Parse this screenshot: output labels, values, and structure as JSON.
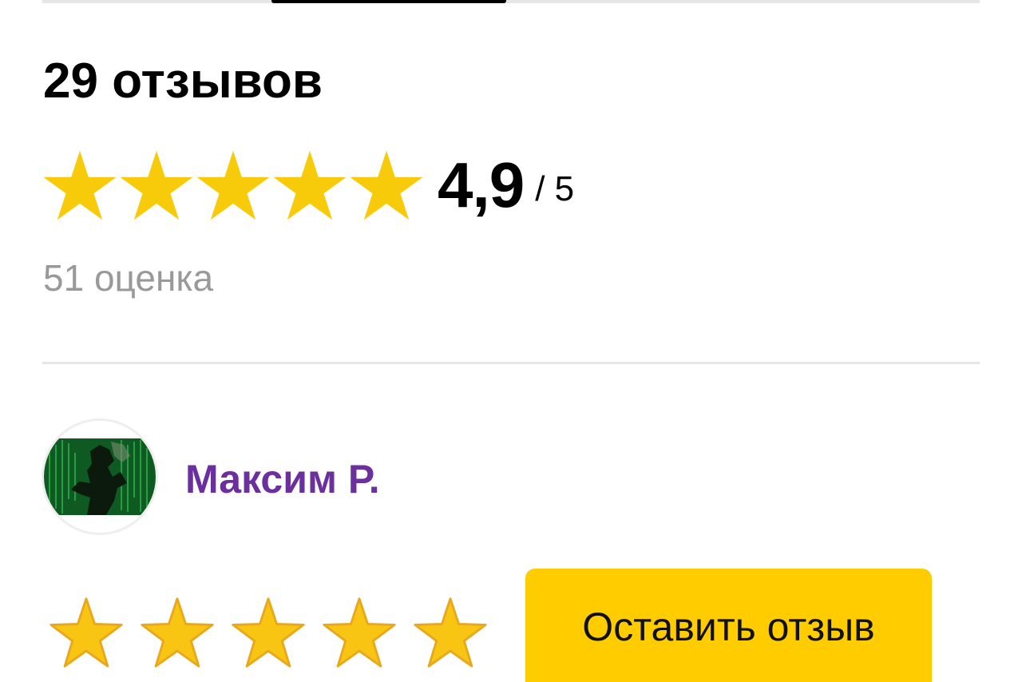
{
  "reviews": {
    "title": "29 отзывов",
    "rating_value": "4,9",
    "rating_max": "/ 5",
    "ratings_count": "51 оценка",
    "overall_stars": 5
  },
  "review": {
    "author": "Максим Р.",
    "stars": 5
  },
  "actions": {
    "leave_review_label": "Оставить отзыв"
  },
  "colors": {
    "star": "#f8cb0a",
    "star_outline": "#e9a81b",
    "author": "#6b2f9e",
    "button": "#ffcc00",
    "muted_text": "#999999"
  },
  "icons": {
    "rating_star": "star-icon",
    "avatar": "user-avatar-image"
  }
}
